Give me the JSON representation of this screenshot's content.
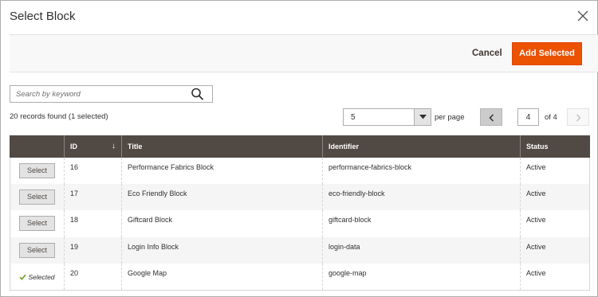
{
  "modal": {
    "title": "Select Block",
    "cancel_label": "Cancel",
    "add_selected_label": "Add Selected"
  },
  "search": {
    "placeholder": "Search by keyword",
    "value": ""
  },
  "records_summary": "20 records found (1 selected)",
  "pagination": {
    "per_page_value": "5",
    "per_page_label": "per page",
    "current_page": "4",
    "total_label": "of 4"
  },
  "grid": {
    "columns": [
      "",
      "ID",
      "Title",
      "Identifier",
      "Status"
    ],
    "sort_indicator": "↓",
    "rows": [
      {
        "action": "Select",
        "id": "16",
        "title": "Performance Fabrics Block",
        "identifier": "performance-fabrics-block",
        "status": "Active"
      },
      {
        "action": "Select",
        "id": "17",
        "title": "Eco Friendly Block",
        "identifier": "eco-friendly-block",
        "status": "Active"
      },
      {
        "action": "Select",
        "id": "18",
        "title": "Giftcard Block",
        "identifier": "giftcard-block",
        "status": "Active"
      },
      {
        "action": "Select",
        "id": "19",
        "title": "Login Info Block",
        "identifier": "login-data",
        "status": "Active"
      },
      {
        "action": "Selected",
        "id": "20",
        "title": "Google Map",
        "identifier": "google-map",
        "status": "Active"
      }
    ]
  },
  "colors": {
    "primary_button": "#eb5202",
    "grid_header": "#514943",
    "selected_check": "#79a22e"
  },
  "icons": {
    "close": "close-icon",
    "search": "search-icon",
    "dropdown": "chevron-down-icon",
    "prev": "chevron-left-icon",
    "next": "chevron-right-icon",
    "check": "check-icon"
  }
}
